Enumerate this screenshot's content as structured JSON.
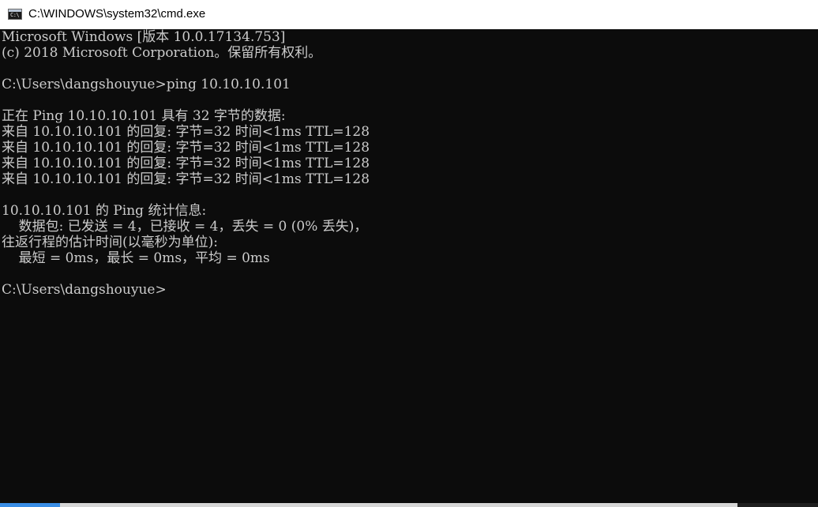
{
  "window": {
    "title": "C:\\WINDOWS\\system32\\cmd.exe",
    "icon": "cmd-icon",
    "icon_glyph": "C:\\"
  },
  "console": {
    "lines": [
      "Microsoft Windows [版本 10.0.17134.753]",
      "(c) 2018 Microsoft Corporation。保留所有权利。",
      "",
      "C:\\Users\\dangshouyue>ping 10.10.10.101",
      "",
      "正在 Ping 10.10.10.101 具有 32 字节的数据:",
      "来自 10.10.10.101 的回复: 字节=32 时间<1ms TTL=128",
      "来自 10.10.10.101 的回复: 字节=32 时间<1ms TTL=128",
      "来自 10.10.10.101 的回复: 字节=32 时间<1ms TTL=128",
      "来自 10.10.10.101 的回复: 字节=32 时间<1ms TTL=128",
      "",
      "10.10.10.101 的 Ping 统计信息:",
      "    数据包: 已发送 = 4，已接收 = 4，丢失 = 0 (0% 丢失)，",
      "往返行程的估计时间(以毫秒为单位):",
      "    最短 = 0ms，最长 = 0ms，平均 = 0ms",
      "",
      "C:\\Users\\dangshouyue>"
    ]
  },
  "colors": {
    "console_bg": "#0c0c0c",
    "console_text": "#cccccc",
    "titlebar_bg": "#ffffff"
  }
}
